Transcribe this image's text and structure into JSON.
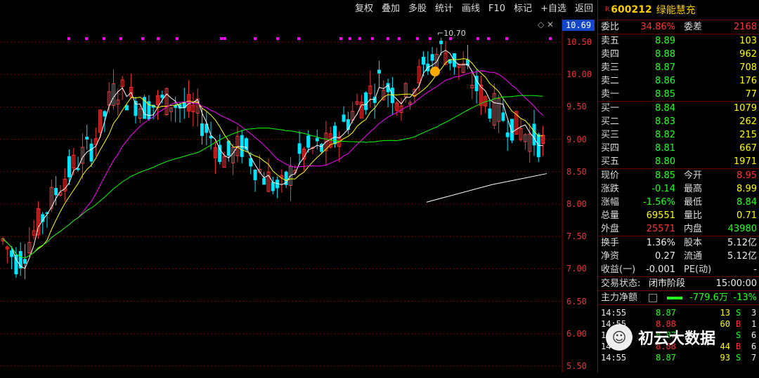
{
  "toolbar": {
    "items": [
      "复权",
      "叠加",
      "多股",
      "统计",
      "画线",
      "F10",
      "标记",
      "+自选",
      "返回"
    ]
  },
  "chart": {
    "current_price_label": "10.69",
    "high_marker": "10.70",
    "y_ticks": [
      "10.50",
      "10.00",
      "9.50",
      "9.00",
      "8.50",
      "8.00",
      "7.50",
      "7.00",
      "6.50",
      "6.00",
      "5.50"
    ],
    "colors": {
      "up": "#ff3333",
      "down": "#00e5ff",
      "ma5": "#ffffff",
      "ma10": "#ffff00",
      "ma20": "#ff00ff",
      "ma60": "#00ff00",
      "ma250": "#ffffff"
    }
  },
  "stock": {
    "r_mark": "R",
    "code": "600212",
    "name": "绿能慧充"
  },
  "weibi": {
    "label1": "委比",
    "value1": "34.86%",
    "label2": "委差",
    "value2": "2168"
  },
  "asks": [
    {
      "label": "卖五",
      "price": "8.89",
      "vol": "103"
    },
    {
      "label": "卖四",
      "price": "8.88",
      "vol": "962"
    },
    {
      "label": "卖三",
      "price": "8.87",
      "vol": "708"
    },
    {
      "label": "卖二",
      "price": "8.86",
      "vol": "176"
    },
    {
      "label": "卖一",
      "price": "8.85",
      "vol": "77"
    }
  ],
  "bids": [
    {
      "label": "买一",
      "price": "8.84",
      "vol": "1079"
    },
    {
      "label": "买二",
      "price": "8.83",
      "vol": "262"
    },
    {
      "label": "买三",
      "price": "8.82",
      "vol": "215"
    },
    {
      "label": "买四",
      "price": "8.81",
      "vol": "667"
    },
    {
      "label": "买五",
      "price": "8.80",
      "vol": "1971"
    }
  ],
  "quote": {
    "xianjia": {
      "label": "现价",
      "value": "8.85",
      "label2": "今开",
      "value2": "8.95"
    },
    "zhangdie": {
      "label": "涨跌",
      "value": "-0.14",
      "label2": "最高",
      "value2": "8.99"
    },
    "zhangfu": {
      "label": "涨幅",
      "value": "-1.56%",
      "label2": "最低",
      "value2": "8.84"
    },
    "zongliang": {
      "label": "总量",
      "value": "69551",
      "label2": "量比",
      "value2": "0.71"
    },
    "waipan": {
      "label": "外盘",
      "value": "25571",
      "label2": "内盘",
      "value2": "43980"
    },
    "huanshou": {
      "label": "换手",
      "value": "1.36%",
      "label2": "股本",
      "value2": "5.12亿"
    },
    "jingzi": {
      "label": "净资",
      "value": "0.27",
      "label2": "流通",
      "value2": "5.12亿"
    },
    "shouyi": {
      "label": "收益(一)",
      "value": "-0.001",
      "label2": "PE(动)",
      "value2": "-"
    }
  },
  "status": {
    "label": "交易状态:",
    "value": "闭市阶段",
    "time": "15:00:00"
  },
  "zhuli": {
    "label": "主力净额",
    "value": "-779.6万",
    "pct": "-13%"
  },
  "trades": [
    {
      "time": "14:55",
      "price": "8.87",
      "vol": "13",
      "side": "S",
      "n": "3"
    },
    {
      "time": "14:55",
      "price": "8.88",
      "vol": "60",
      "side": "B",
      "n": "1"
    },
    {
      "time": "14:55",
      "price": "8.87",
      "vol": "",
      "side": "S",
      "n": "6"
    },
    {
      "time": "14:55",
      "price": "8.88",
      "vol": "44",
      "side": "B",
      "n": "6"
    },
    {
      "time": "14:55",
      "price": "8.87",
      "vol": "93",
      "side": "S",
      "n": "7"
    }
  ],
  "watermark": {
    "text": "初云大数据"
  }
}
